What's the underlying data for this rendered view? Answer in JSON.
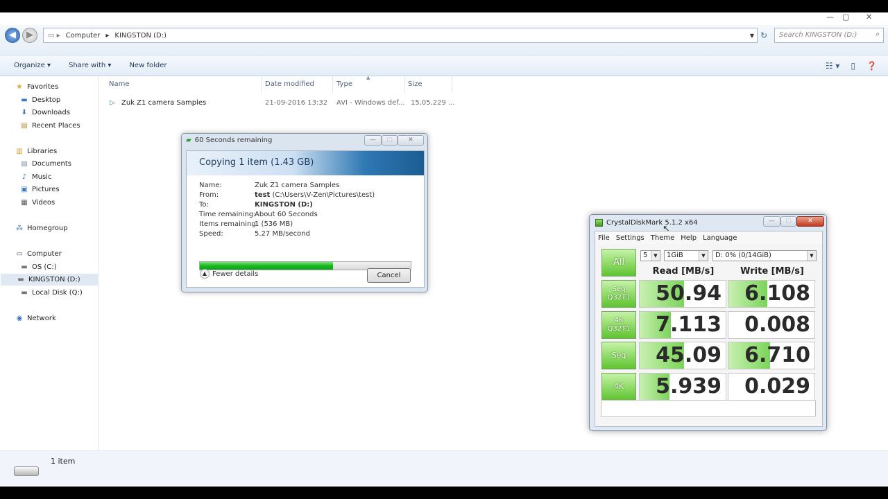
{
  "explorer": {
    "breadcrumb": [
      "Computer",
      "KINGSTON (D:)"
    ],
    "search_placeholder": "Search KINGSTON (D:)",
    "commands": {
      "organize": "Organize ▾",
      "share": "Share with ▾",
      "new_folder": "New folder"
    },
    "nav": {
      "favorites": "Favorites",
      "desktop": "Desktop",
      "downloads": "Downloads",
      "recent": "Recent Places",
      "libraries": "Libraries",
      "documents": "Documents",
      "music": "Music",
      "pictures": "Pictures",
      "videos": "Videos",
      "homegroup": "Homegroup",
      "computer": "Computer",
      "osc": "OS (C:)",
      "kingston": "KINGSTON (D:)",
      "locald": "Local Disk (Q:)",
      "network": "Network"
    },
    "columns": {
      "name": "Name",
      "date": "Date modified",
      "type": "Type",
      "size": "Size"
    },
    "files": [
      {
        "name": "Zuk Z1 camera Samples",
        "date": "21-09-2016 13:32",
        "type": "AVI - Windows def...",
        "size": "15,05,229 ..."
      }
    ],
    "status": "1 item"
  },
  "copy_dialog": {
    "title": "60 Seconds remaining",
    "heading": "Copying 1 item (1.43 GB)",
    "labels": {
      "name": "Name:",
      "from": "From:",
      "to": "To:",
      "time": "Time remaining:",
      "items": "Items remaining:",
      "speed": "Speed:"
    },
    "values": {
      "name": "Zuk Z1 camera Samples",
      "from_bold": "test",
      "from_path": "(C:\\Users\\V-Zen\\Pictures\\test)",
      "to": "KINGSTON (D:)",
      "time": "About 60 Seconds",
      "items": "1 (536 MB)",
      "speed": "5.27 MB/second"
    },
    "progress": 0.63,
    "fewer_details": "Fewer details",
    "cancel": "Cancel"
  },
  "crystaldiskmark": {
    "title": "CrystalDiskMark 5.1.2 x64",
    "menu": [
      "File",
      "Settings",
      "Theme",
      "Help",
      "Language"
    ],
    "all_button": "All",
    "count": "5",
    "size": "1GiB",
    "drive": "D: 0% (0/14GiB)",
    "read_header": "Read [MB/s]",
    "write_header": "Write [MB/s]",
    "rows": [
      {
        "line1": "Seq",
        "line2": "Q32T1",
        "read": "50.94",
        "write": "6.108",
        "read_fill": 0.52,
        "write_fill": 0.45
      },
      {
        "line1": "4K",
        "line2": "Q32T1",
        "read": "7.113",
        "write": "0.008",
        "read_fill": 0.36,
        "write_fill": 0.0
      },
      {
        "line1": "Seq",
        "line2": "",
        "read": "45.09",
        "write": "6.710",
        "read_fill": 0.52,
        "write_fill": 0.48
      },
      {
        "line1": "4K",
        "line2": "",
        "read": "5.939",
        "write": "0.029",
        "read_fill": 0.35,
        "write_fill": 0.0
      }
    ],
    "comment": ""
  }
}
